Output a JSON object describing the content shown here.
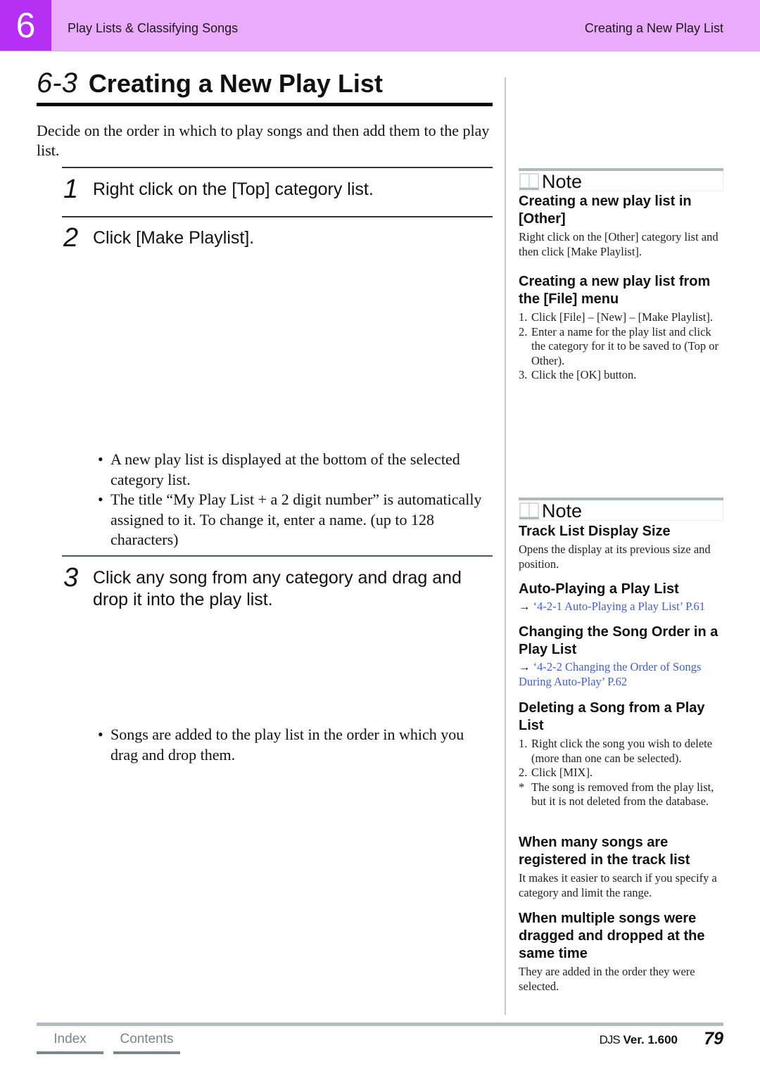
{
  "header": {
    "chapter_number": "6",
    "chapter_title": "Play Lists & Classifying Songs",
    "section_title": "Creating a New Play List",
    "colors": {
      "band": "#ebabfb",
      "chapter_box": "#b52ff5"
    }
  },
  "page": {
    "section_number": "6-3",
    "title": "Creating a New Play List",
    "intro": "Decide on the order in which to play songs and then add them to the play list."
  },
  "steps": [
    {
      "number": "1",
      "text": "Right click on the [Top] category list."
    },
    {
      "number": "2",
      "text": "Click [Make Playlist].",
      "bullets": [
        "A new play list is displayed at the bottom of the selected category list.",
        "The title “My Play List + a 2 digit number” is automatically assigned to it. To change it, enter a name. (up to 128 characters)"
      ]
    },
    {
      "number": "3",
      "text": "Click any song from any category and drag and drop it into the play list.",
      "bullets": [
        "Songs are added to the play list in the order in which you drag and drop them."
      ]
    }
  ],
  "sidebar": {
    "note1": {
      "label": "Note",
      "sections": [
        {
          "heading": "Creating a new play list in [Other]",
          "body": "Right click on the [Other] category list and then click [Make Playlist]."
        },
        {
          "heading": "Creating a new play list from the [File] menu",
          "items": [
            {
              "n": "1.",
              "text": "Click [File] – [New] – [Make Playlist]."
            },
            {
              "n": "2.",
              "text": "Enter a name for the play list and click the category for it to be saved to (Top or Other)."
            },
            {
              "n": "3.",
              "text": "Click the [OK] button."
            }
          ]
        }
      ]
    },
    "note2": {
      "label": "Note",
      "sections": [
        {
          "heading": "Track List Display Size",
          "body": "Opens the display at its previous size and position."
        },
        {
          "heading": "Auto-Playing a Play List",
          "link_arrow": "→",
          "link": "‘4-2-1 Auto-Playing a Play List’ P.61"
        },
        {
          "heading": "Changing the Song Order in a Play List",
          "link_arrow": "→",
          "link": "‘4-2-2 Changing the Order of Songs During Auto-Play’ P.62"
        },
        {
          "heading": "Deleting a Song from a Play List",
          "items": [
            {
              "n": "1.",
              "text": "Right click the song you wish to delete (more than one can be selected)."
            },
            {
              "n": "2.",
              "text": "Click [MIX]."
            },
            {
              "n": "*",
              "text": "The song is removed from the play list, but it is not deleted from the database."
            }
          ]
        },
        {
          "heading": "When many songs are registered in the track list",
          "body": "It makes it easier to search if you specify a category and limit the range."
        },
        {
          "heading": "When multiple songs were dragged and dropped at the same time",
          "body": "They are added in the order they were selected."
        }
      ]
    },
    "link_color": "#3d5cf0"
  },
  "footer": {
    "index_label": "Index",
    "contents_label": "Contents",
    "brand": "DJS",
    "version": "Ver. 1.600",
    "page_number": "79"
  }
}
